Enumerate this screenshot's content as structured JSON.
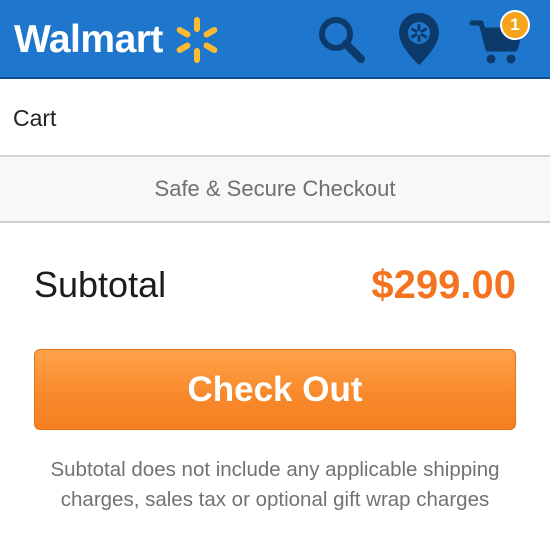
{
  "header": {
    "logo_text": "Walmart",
    "logo_spark_icon": "walmart-spark-icon",
    "search_icon": "search-icon",
    "store_locator_icon": "store-locator-icon",
    "cart_icon": "cart-icon",
    "cart_badge_count": "1",
    "colors": {
      "header_background": "#1e76cd",
      "icon_dark": "#0b3a6b",
      "spark_yellow": "#fdbb30",
      "badge": "#f7a41d"
    }
  },
  "page": {
    "title": "Cart"
  },
  "secure_bar": {
    "text": "Safe & Secure Checkout"
  },
  "summary": {
    "subtotal_label": "Subtotal",
    "subtotal_value": "$299.00",
    "colors": {
      "subtotal_value": "#f47321"
    }
  },
  "checkout": {
    "button_label": "Check Out",
    "colors": {
      "button": "#f88a2c"
    }
  },
  "disclaimer": {
    "text": "Subtotal does not include any applicable shipping charges, sales tax or optional gift wrap charges"
  }
}
